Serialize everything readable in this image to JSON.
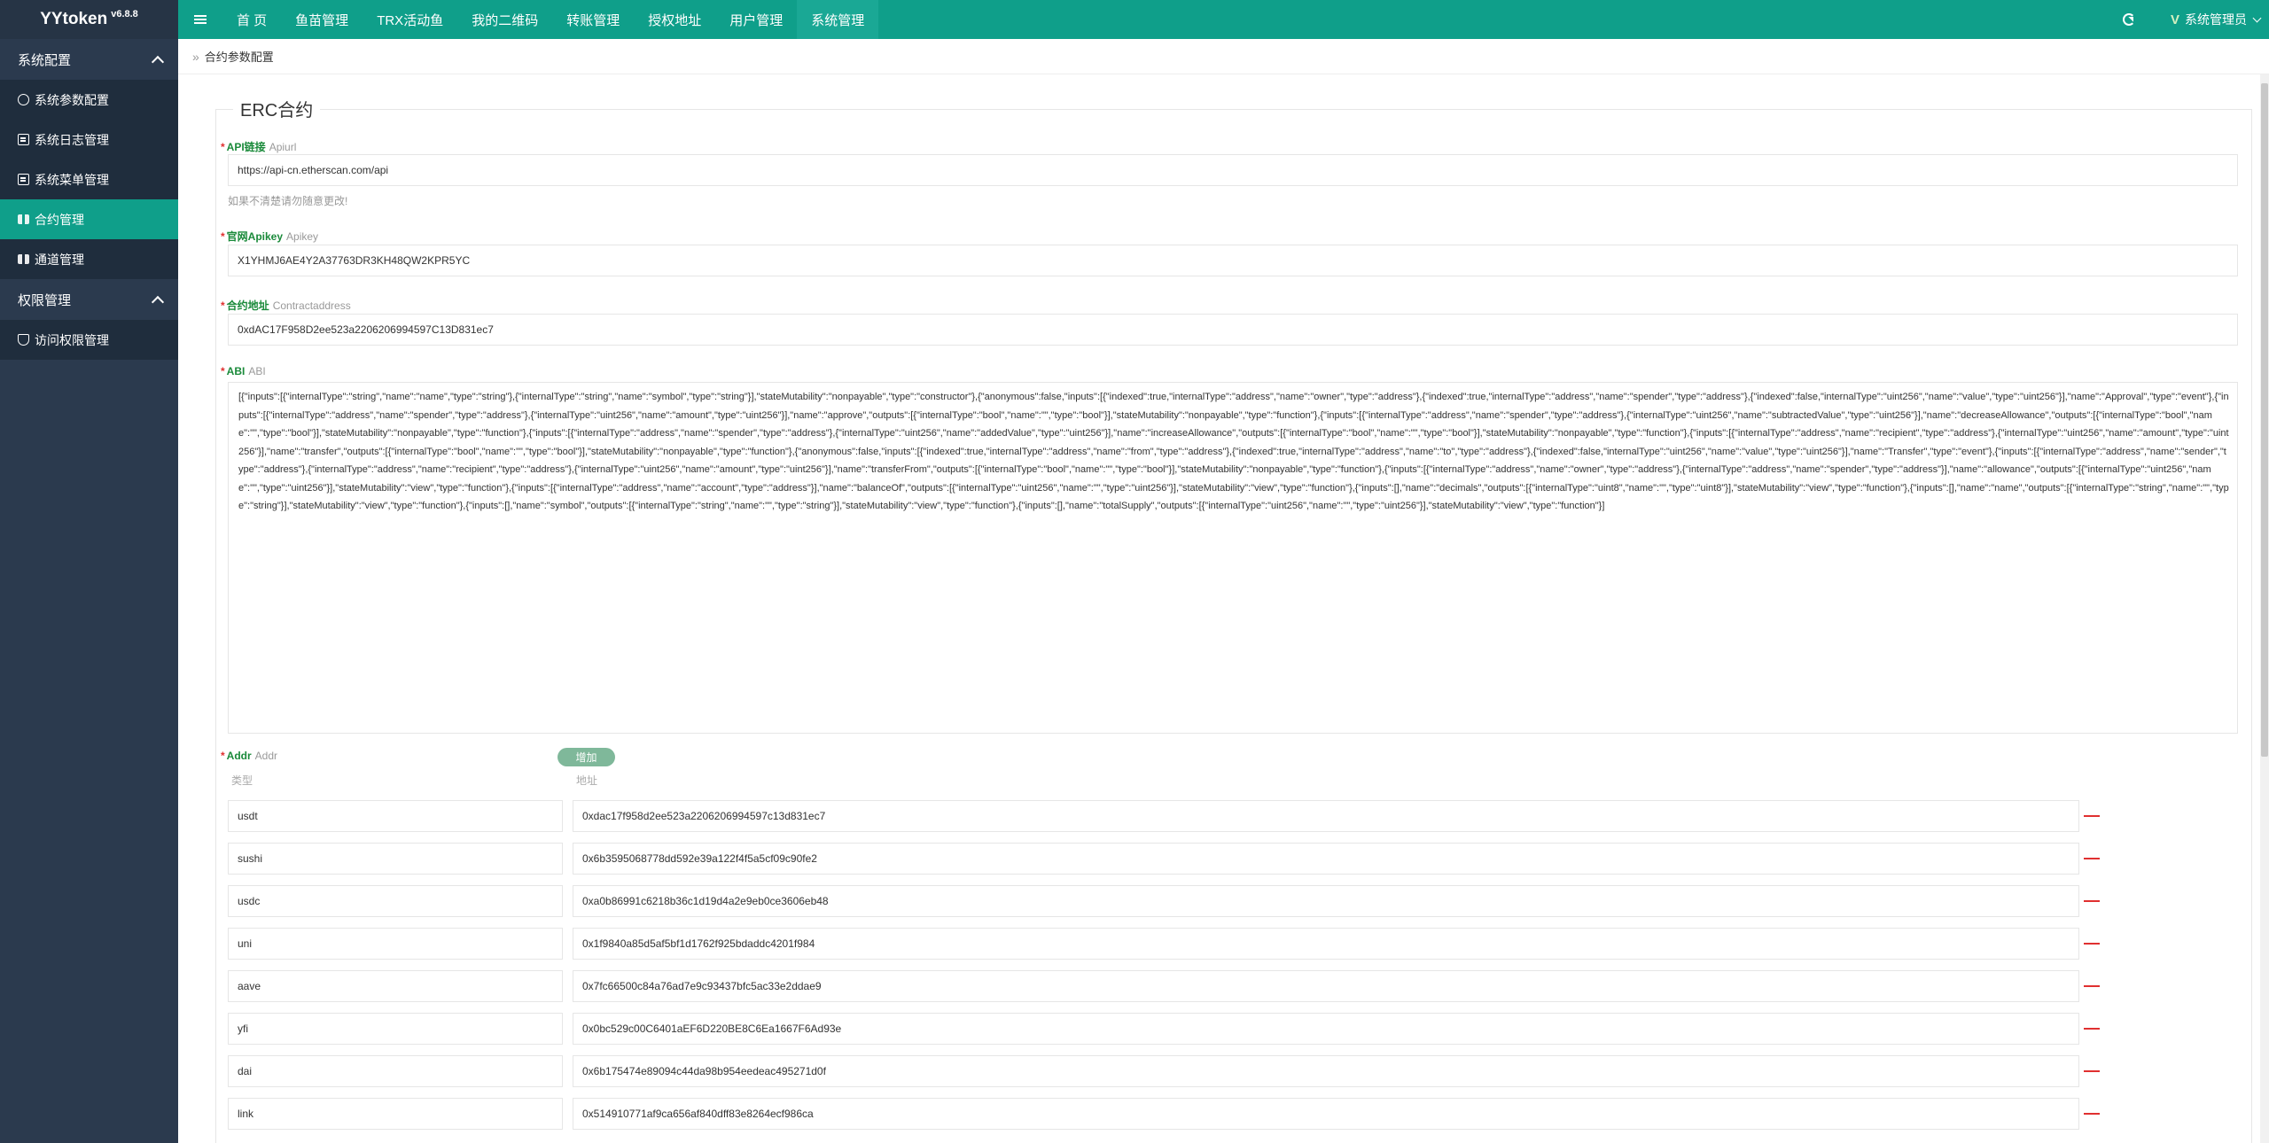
{
  "brand": {
    "name": "YYtoken",
    "version": "v6.8.8"
  },
  "sidebar": {
    "groups": [
      {
        "label": "系统配置",
        "items": [
          {
            "label": "系统参数配置",
            "icon": "gear-icon"
          },
          {
            "label": "系统日志管理",
            "icon": "book-icon"
          },
          {
            "label": "系统菜单管理",
            "icon": "book-icon"
          },
          {
            "label": "合约管理",
            "icon": "grid-icon",
            "active": true
          },
          {
            "label": "通道管理",
            "icon": "grid-icon"
          }
        ]
      },
      {
        "label": "权限管理",
        "items": [
          {
            "label": "访问权限管理",
            "icon": "shield-icon"
          }
        ]
      }
    ]
  },
  "topbar": {
    "nav": [
      "首 页",
      "鱼苗管理",
      "TRX活动鱼",
      "我的二维码",
      "转账管理",
      "授权地址",
      "用户管理",
      "系统管理"
    ],
    "active_nav": "系统管理",
    "user": {
      "logo": "V",
      "name": "系统管理员"
    }
  },
  "breadcrumb": "合约参数配置",
  "form": {
    "legend": "ERC合约",
    "api": {
      "label": "API链接",
      "sub": "Apiurl",
      "value": "https://api-cn.etherscan.com/api",
      "hint": "如果不清楚请勿随意更改!"
    },
    "apikey": {
      "label": "官网Apikey",
      "sub": "Apikey",
      "value": "X1YHMJ6AE4Y2A37763DR3KH48QW2KPR5YC"
    },
    "contract": {
      "label": "合约地址",
      "sub": "Contractaddress",
      "value": "0xdAC17F958D2ee523a2206206994597C13D831ec7"
    },
    "abi": {
      "label": "ABI",
      "sub": "ABI",
      "value": "[{\"inputs\":[{\"internalType\":\"string\",\"name\":\"name\",\"type\":\"string\"},{\"internalType\":\"string\",\"name\":\"symbol\",\"type\":\"string\"}],\"stateMutability\":\"nonpayable\",\"type\":\"constructor\"},{\"anonymous\":false,\"inputs\":[{\"indexed\":true,\"internalType\":\"address\",\"name\":\"owner\",\"type\":\"address\"},{\"indexed\":true,\"internalType\":\"address\",\"name\":\"spender\",\"type\":\"address\"},{\"indexed\":false,\"internalType\":\"uint256\",\"name\":\"value\",\"type\":\"uint256\"}],\"name\":\"Approval\",\"type\":\"event\"},{\"inputs\":[{\"internalType\":\"address\",\"name\":\"spender\",\"type\":\"address\"},{\"internalType\":\"uint256\",\"name\":\"amount\",\"type\":\"uint256\"}],\"name\":\"approve\",\"outputs\":[{\"internalType\":\"bool\",\"name\":\"\",\"type\":\"bool\"}],\"stateMutability\":\"nonpayable\",\"type\":\"function\"},{\"inputs\":[{\"internalType\":\"address\",\"name\":\"spender\",\"type\":\"address\"},{\"internalType\":\"uint256\",\"name\":\"subtractedValue\",\"type\":\"uint256\"}],\"name\":\"decreaseAllowance\",\"outputs\":[{\"internalType\":\"bool\",\"name\":\"\",\"type\":\"bool\"}],\"stateMutability\":\"nonpayable\",\"type\":\"function\"},{\"inputs\":[{\"internalType\":\"address\",\"name\":\"spender\",\"type\":\"address\"},{\"internalType\":\"uint256\",\"name\":\"addedValue\",\"type\":\"uint256\"}],\"name\":\"increaseAllowance\",\"outputs\":[{\"internalType\":\"bool\",\"name\":\"\",\"type\":\"bool\"}],\"stateMutability\":\"nonpayable\",\"type\":\"function\"},{\"inputs\":[{\"internalType\":\"address\",\"name\":\"recipient\",\"type\":\"address\"},{\"internalType\":\"uint256\",\"name\":\"amount\",\"type\":\"uint256\"}],\"name\":\"transfer\",\"outputs\":[{\"internalType\":\"bool\",\"name\":\"\",\"type\":\"bool\"}],\"stateMutability\":\"nonpayable\",\"type\":\"function\"},{\"anonymous\":false,\"inputs\":[{\"indexed\":true,\"internalType\":\"address\",\"name\":\"from\",\"type\":\"address\"},{\"indexed\":true,\"internalType\":\"address\",\"name\":\"to\",\"type\":\"address\"},{\"indexed\":false,\"internalType\":\"uint256\",\"name\":\"value\",\"type\":\"uint256\"}],\"name\":\"Transfer\",\"type\":\"event\"},{\"inputs\":[{\"internalType\":\"address\",\"name\":\"sender\",\"type\":\"address\"},{\"internalType\":\"address\",\"name\":\"recipient\",\"type\":\"address\"},{\"internalType\":\"uint256\",\"name\":\"amount\",\"type\":\"uint256\"}],\"name\":\"transferFrom\",\"outputs\":[{\"internalType\":\"bool\",\"name\":\"\",\"type\":\"bool\"}],\"stateMutability\":\"nonpayable\",\"type\":\"function\"},{\"inputs\":[{\"internalType\":\"address\",\"name\":\"owner\",\"type\":\"address\"},{\"internalType\":\"address\",\"name\":\"spender\",\"type\":\"address\"}],\"name\":\"allowance\",\"outputs\":[{\"internalType\":\"uint256\",\"name\":\"\",\"type\":\"uint256\"}],\"stateMutability\":\"view\",\"type\":\"function\"},{\"inputs\":[{\"internalType\":\"address\",\"name\":\"account\",\"type\":\"address\"}],\"name\":\"balanceOf\",\"outputs\":[{\"internalType\":\"uint256\",\"name\":\"\",\"type\":\"uint256\"}],\"stateMutability\":\"view\",\"type\":\"function\"},{\"inputs\":[],\"name\":\"decimals\",\"outputs\":[{\"internalType\":\"uint8\",\"name\":\"\",\"type\":\"uint8\"}],\"stateMutability\":\"view\",\"type\":\"function\"},{\"inputs\":[],\"name\":\"name\",\"outputs\":[{\"internalType\":\"string\",\"name\":\"\",\"type\":\"string\"}],\"stateMutability\":\"view\",\"type\":\"function\"},{\"inputs\":[],\"name\":\"symbol\",\"outputs\":[{\"internalType\":\"string\",\"name\":\"\",\"type\":\"string\"}],\"stateMutability\":\"view\",\"type\":\"function\"},{\"inputs\":[],\"name\":\"totalSupply\",\"outputs\":[{\"internalType\":\"uint256\",\"name\":\"\",\"type\":\"uint256\"}],\"stateMutability\":\"view\",\"type\":\"function\"}]"
    },
    "addr": {
      "label": "Addr",
      "sub": "Addr",
      "add_label": "增加",
      "col_type": "类型",
      "col_addr": "地址",
      "rows": [
        {
          "type": "usdt",
          "addr": "0xdac17f958d2ee523a2206206994597c13d831ec7"
        },
        {
          "type": "sushi",
          "addr": "0x6b3595068778dd592e39a122f4f5a5cf09c90fe2"
        },
        {
          "type": "usdc",
          "addr": "0xa0b86991c6218b36c1d19d4a2e9eb0ce3606eb48"
        },
        {
          "type": "uni",
          "addr": "0x1f9840a85d5af5bf1d1762f925bdaddc4201f984"
        },
        {
          "type": "aave",
          "addr": "0x7fc66500c84a76ad7e9c93437bfc5ac33e2ddae9"
        },
        {
          "type": "yfi",
          "addr": "0x0bc529c00C6401aEF6D220BE8C6Ea1667F6Ad93e"
        },
        {
          "type": "dai",
          "addr": "0x6b175474e89094c44da98b954eedeac495271d0f"
        },
        {
          "type": "link",
          "addr": "0x514910771af9ca656af840dff83e8264ecf986ca"
        }
      ]
    }
  },
  "colors": {
    "primary": "#0f9f8a",
    "sidebar": "#2b3a4e",
    "sidebar_item": "#1f2d3d",
    "label_green": "#1a8a3a",
    "required": "#e03030"
  }
}
